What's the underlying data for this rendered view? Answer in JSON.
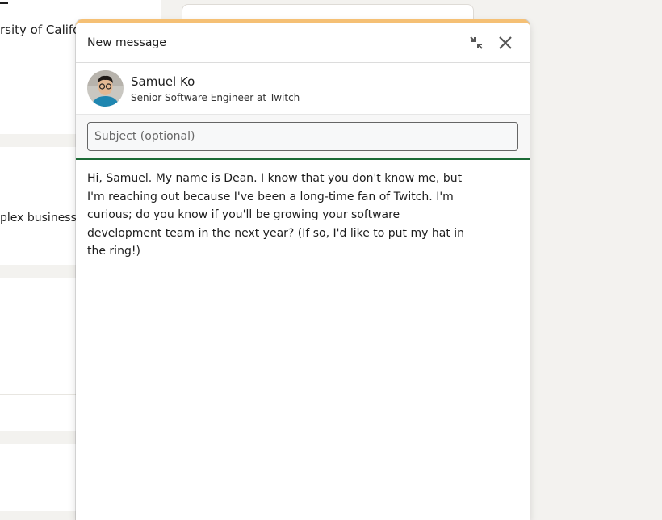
{
  "background": {
    "school_fragment": "rsity of Califor",
    "business_fragment": "plex business"
  },
  "dialog": {
    "title": "New message",
    "collapse_icon": "collapse-icon",
    "close_icon": "close-icon",
    "accent_color": "#f5c075"
  },
  "recipient": {
    "name": "Samuel Ko",
    "headline": "Senior Software Engineer at Twitch"
  },
  "subject": {
    "placeholder": "Subject (optional)",
    "value": ""
  },
  "message": {
    "body": "Hi, Samuel. My name is Dean. I know that you don't know me, but I'm reaching out because I've been a long-time fan of Twitch. I'm curious; do you know if you'll be growing your software development team in the next year? (If so, I'd like to put my hat in the ring!)"
  }
}
